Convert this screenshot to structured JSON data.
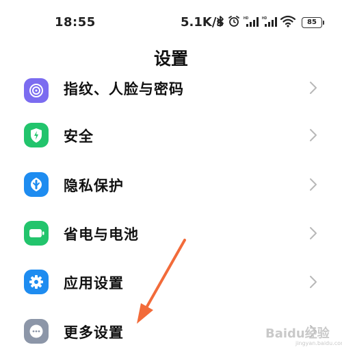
{
  "status_bar": {
    "time": "18:55",
    "net_speed": "5.1K/s",
    "battery_level": "85",
    "icons": [
      "bluetooth-icon",
      "alarm-icon",
      "hd-signal-icon",
      "hd-signal-icon",
      "wifi-icon",
      "battery-icon"
    ]
  },
  "header": {
    "title": "设置"
  },
  "settings": {
    "items": [
      {
        "label": "指纹、人脸与密码",
        "icon": "fingerprint-icon",
        "icon_color": "#7B6CF0"
      },
      {
        "label": "安全",
        "icon": "shield-icon",
        "icon_color": "#22C46C"
      },
      {
        "label": "隐私保护",
        "icon": "privacy-icon",
        "icon_color": "#1E8CF0"
      },
      {
        "label": "省电与电池",
        "icon": "battery-saver-icon",
        "icon_color": "#22C46C"
      },
      {
        "label": "应用设置",
        "icon": "gear-icon",
        "icon_color": "#1E8CF0"
      },
      {
        "label": "更多设置",
        "icon": "more-icon",
        "icon_color": "#8C96A8"
      }
    ]
  },
  "annotation": {
    "arrow_color": "#F26B3A"
  },
  "watermark": {
    "text": "Baidu经验",
    "sub": "jingyan.baidu.com"
  }
}
